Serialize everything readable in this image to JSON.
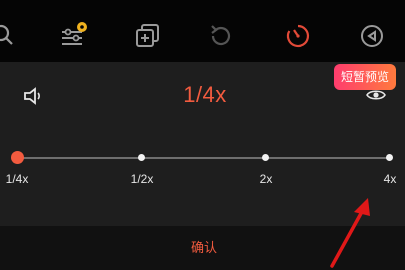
{
  "toolbar": {
    "icons": [
      "search-icon",
      "adjust-sliders-icon",
      "copy-add-icon",
      "rotate-icon",
      "speed-timer-icon",
      "back-circle-icon"
    ],
    "active_color": "#e24a38"
  },
  "speed_panel": {
    "current_speed": "1/4x",
    "preview_badge": "短暂预览",
    "slider": {
      "labels": [
        "1/4x",
        "1/2x",
        "2x",
        "4x"
      ],
      "selected_index": 0
    }
  },
  "footer": {
    "confirm_label": "确认"
  },
  "colors": {
    "accent": "#f25b3f",
    "panel_bg": "#1e1e1e",
    "badge_gradient": [
      "#ff3d6e",
      "#ff7a3d"
    ]
  }
}
